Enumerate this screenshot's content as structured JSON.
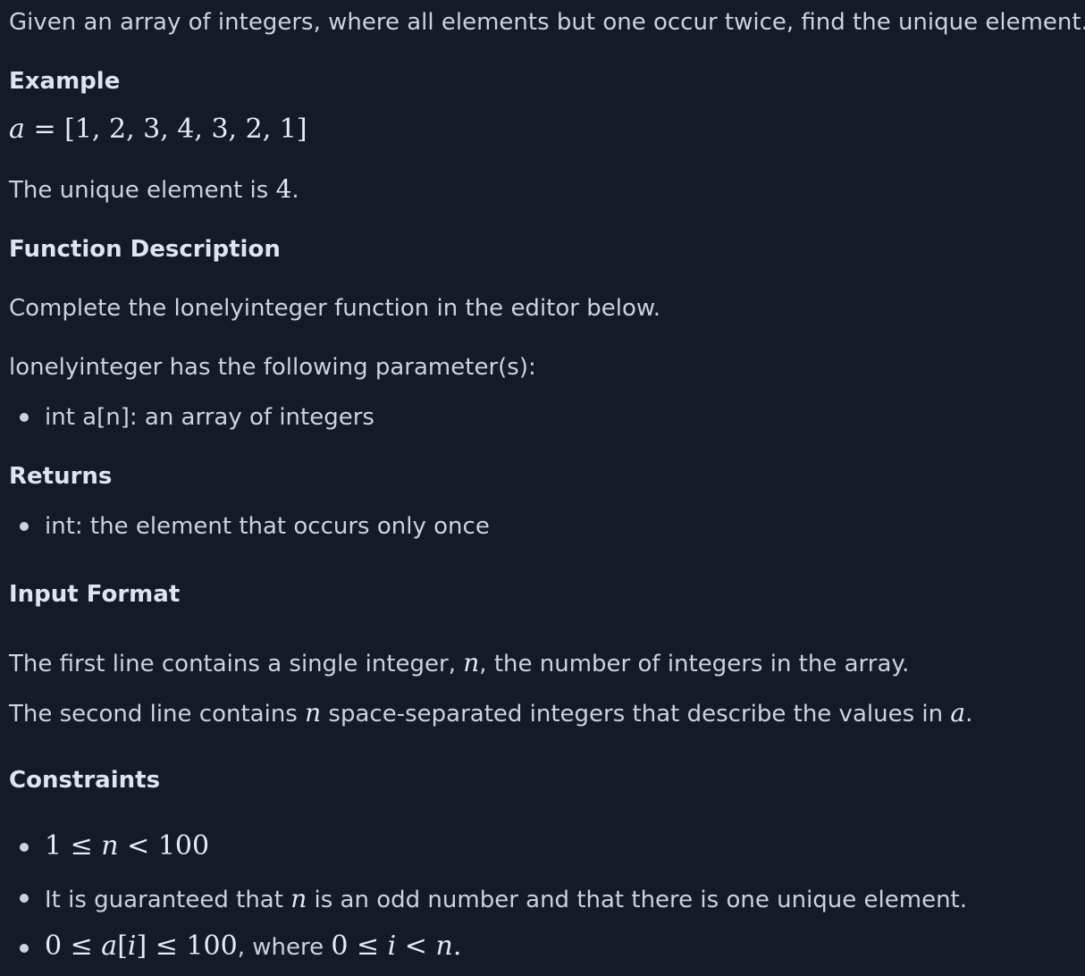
{
  "intro": "Given an array of integers, where all elements but one occur twice, find the unique element.",
  "example": {
    "heading": "Example",
    "var": "a",
    "eq": "=",
    "array": "[1, 2, 3, 4, 3, 2, 1]",
    "result_prefix": "The unique element is ",
    "result_value": "4",
    "result_suffix": "."
  },
  "function_description": {
    "heading": "Function Description",
    "line1": "Complete the lonelyinteger function in the editor below.",
    "line2": "lonelyinteger has the following parameter(s):",
    "params": [
      "int a[n]: an array of integers"
    ]
  },
  "returns": {
    "heading": "Returns",
    "items": [
      "int: the element that occurs only once"
    ]
  },
  "input_format": {
    "heading": "Input Format",
    "line1_a": "The first line contains a single integer, ",
    "line1_var": "n",
    "line1_b": ", the number of integers in the array.",
    "line2_a": "The second line contains ",
    "line2_var": "n",
    "line2_b": " space-separated integers that describe the values in ",
    "line2_var2": "a",
    "line2_c": "."
  },
  "constraints": {
    "heading": "Constraints",
    "c1_a": "1 ≤ ",
    "c1_var": "n",
    "c1_b": " < 100",
    "c2_a": "It is guaranteed that ",
    "c2_var": "n",
    "c2_b": " is an odd number and that there is one unique element.",
    "c3_a": "0 ≤ ",
    "c3_var": "a",
    "c3_b": "[",
    "c3_var2": "i",
    "c3_c": "] ≤ 100",
    "c3_d": ", where ",
    "c3_e": "0 ≤ ",
    "c3_var3": "i",
    "c3_f": " < ",
    "c3_var4": "n",
    "c3_g": "."
  }
}
